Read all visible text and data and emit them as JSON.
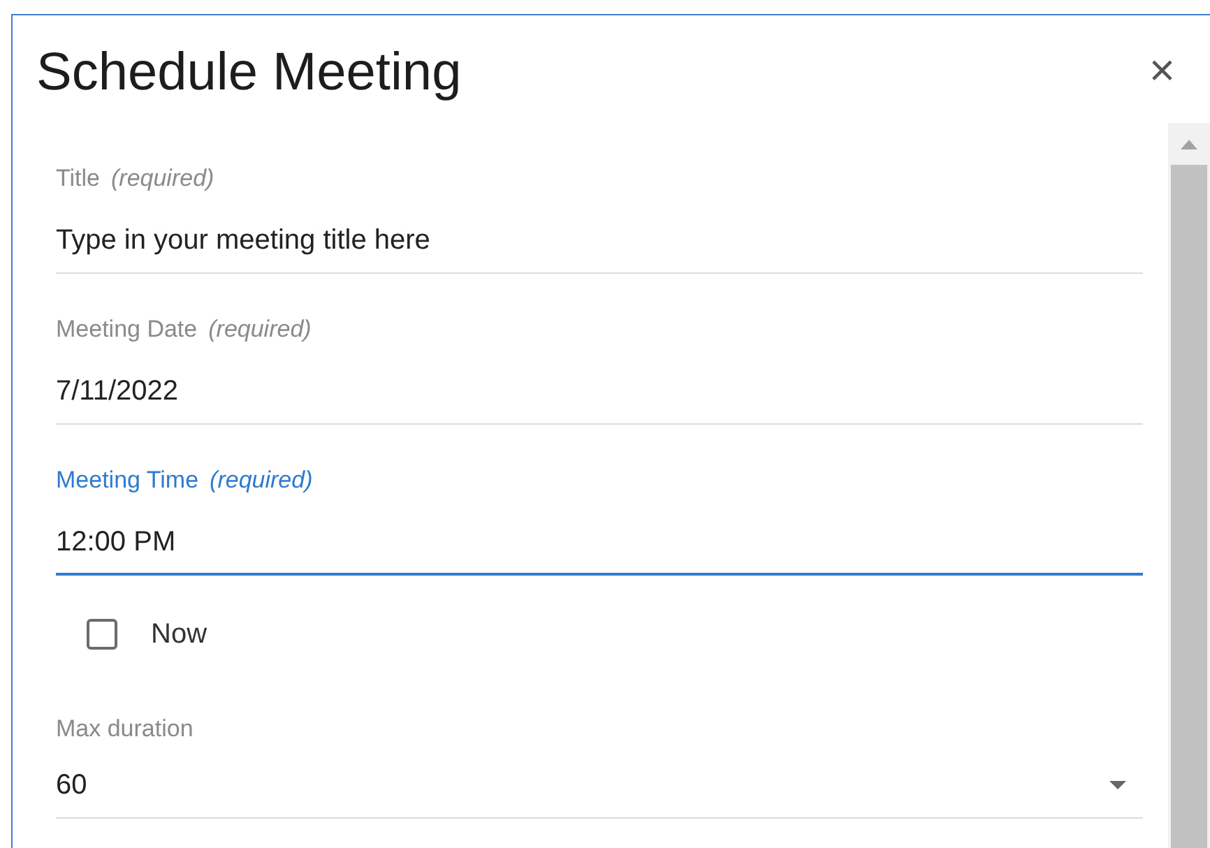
{
  "dialog": {
    "title": "Schedule Meeting",
    "close": "×"
  },
  "fields": [
    {
      "kind": "text",
      "label": "Title",
      "note": "(required)",
      "value": "Type in your meeting title here",
      "focused": false
    },
    {
      "kind": "text",
      "label": "Meeting Date",
      "note": "(required)",
      "value": "7/11/2022",
      "focused": false
    },
    {
      "kind": "text",
      "label": "Meeting Time",
      "note": "(required)",
      "value": "12:00 PM",
      "focused": true
    },
    {
      "kind": "checkbox",
      "label": "Now",
      "checked": false
    },
    {
      "kind": "select",
      "label": "Max duration",
      "value": "60",
      "focused": false
    }
  ]
}
